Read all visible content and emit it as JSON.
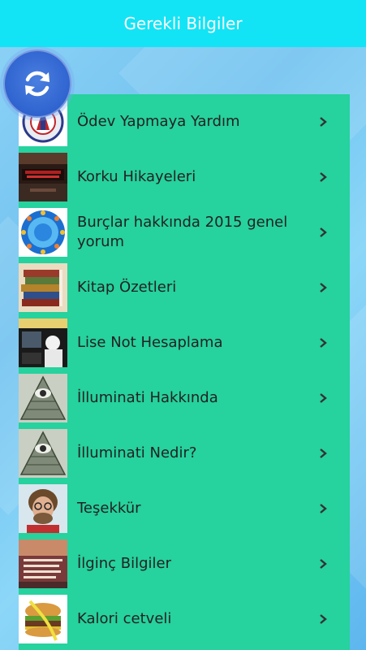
{
  "header": {
    "title": "Gerekli Bilgiler"
  },
  "refresh": {
    "icon": "refresh-icon"
  },
  "items": [
    {
      "label": "Ödev Yapmaya Yardım",
      "thumb": "school-logo"
    },
    {
      "label": "Korku Hikayeleri",
      "thumb": "horror-poster"
    },
    {
      "label": "Burçlar hakkında 2015 genel yorum",
      "thumb": "zodiac-wheel"
    },
    {
      "label": "Kitap Özetleri",
      "thumb": "books-stack"
    },
    {
      "label": "Lise Not Hesaplama",
      "thumb": "student-photo"
    },
    {
      "label": "İlluminati Hakkında",
      "thumb": "eye-pyramid"
    },
    {
      "label": "İlluminati Nedir?",
      "thumb": "eye-pyramid"
    },
    {
      "label": "Teşekkür",
      "thumb": "portrait-photo"
    },
    {
      "label": "İlginç Bilgiler",
      "thumb": "facts-photo"
    },
    {
      "label": "Kalori cetveli",
      "thumb": "burger-measure"
    }
  ],
  "colors": {
    "header": "#12e4f5",
    "list": "#26d29d",
    "refresh": "#2f63cf"
  }
}
